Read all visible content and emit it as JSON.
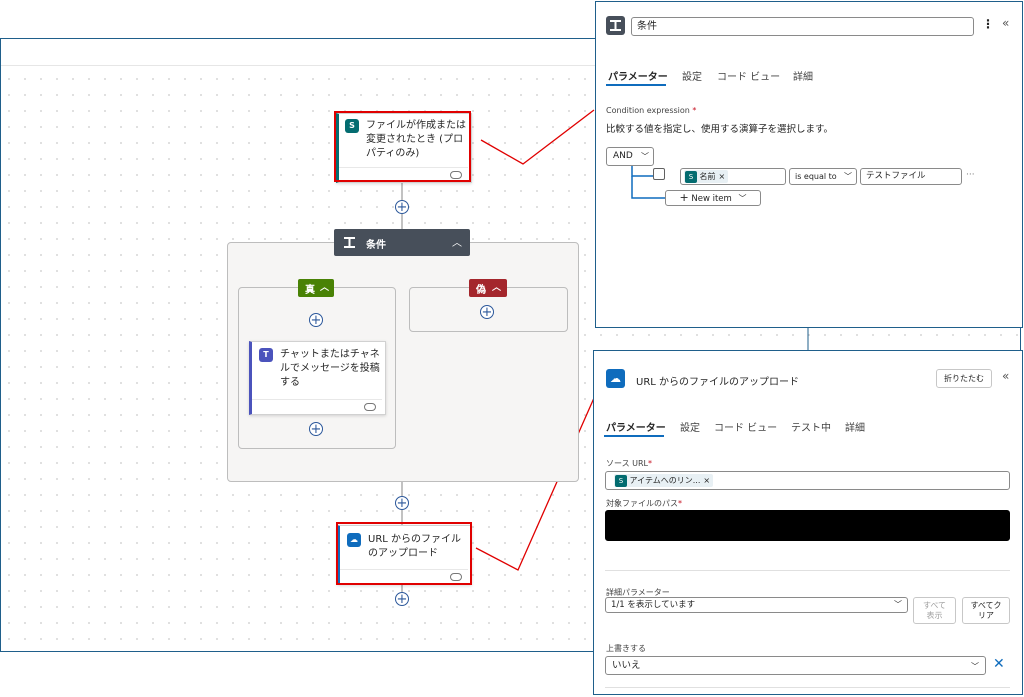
{
  "flow": {
    "trigger": {
      "title": "ファイルが作成または変更されたとき (プロパティのみ)"
    },
    "condition": {
      "title": "条件"
    },
    "branch_true": {
      "label": "真"
    },
    "branch_false": {
      "label": "偽"
    },
    "teams_action": {
      "title": "チャットまたはチャネルでメッセージを投稿する"
    },
    "upload_action": {
      "title": "URL からのファイルのアップロード"
    },
    "add_symbol": "+"
  },
  "condition_panel": {
    "title": "条件",
    "tabs": [
      {
        "label": "パラメーター",
        "active": true
      },
      {
        "label": "設定"
      },
      {
        "label": "コード ビュー"
      },
      {
        "label": "詳細"
      }
    ],
    "expression_label": "Condition expression",
    "required_mark": "*",
    "description": "比較する値を指定し、使用する演算子を選択します。",
    "group_operator": "AND",
    "row": {
      "left_token": "名前",
      "operator": "is equal to",
      "right_value": "テストファイル",
      "more": "···"
    },
    "new_item_label": "New item"
  },
  "upload_panel": {
    "title": "URL からのファイルのアップロード",
    "collapse_label": "折りたたむ",
    "tabs": [
      {
        "label": "パラメーター",
        "active": true
      },
      {
        "label": "設定"
      },
      {
        "label": "コード ビュー"
      },
      {
        "label": "テスト中"
      },
      {
        "label": "詳細"
      }
    ],
    "source_url_label": "ソース URL",
    "source_token": "アイテムへのリン...",
    "dest_path_label": "対象ファイルのパス",
    "advanced_label": "詳細パラメーター",
    "advanced_value": "1/1 を表示しています",
    "show_all_label": "すべて表示",
    "clear_all_label": "すべてクリア",
    "overwrite_label": "上書きする",
    "overwrite_value": "いいえ"
  },
  "colors": {
    "accent": "#0f6cbd",
    "true_branch": "#498205",
    "false_branch": "#a4262c",
    "condition_header": "#474f5a",
    "highlight": "#e00000"
  }
}
